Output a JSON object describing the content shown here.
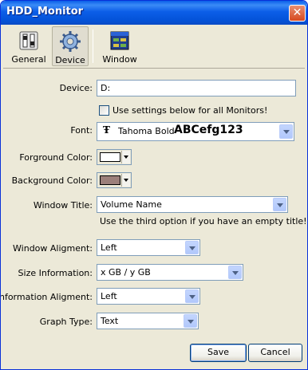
{
  "window": {
    "title": "HDD_Monitor",
    "close_glyph": "✕"
  },
  "toolbar": {
    "items": [
      {
        "label": "General",
        "icon": "switches-icon"
      },
      {
        "label": "Device",
        "icon": "gear-icon",
        "active": true
      },
      {
        "label": "Window",
        "icon": "window-icon"
      }
    ]
  },
  "form": {
    "device": {
      "label": "Device:",
      "value": "D:"
    },
    "use_all": {
      "label": "Use settings below for all Monitors!",
      "checked": false
    },
    "font": {
      "label": "Font:",
      "icon_glyph": "Ŧ",
      "name": "Tahoma Bold",
      "sample": "ABCefg123"
    },
    "foreground": {
      "label": "Forground Color:",
      "color": "#ffffff"
    },
    "background": {
      "label": "Background Color:",
      "color": "#9c7f7a"
    },
    "window_title": {
      "label": "Window Title:",
      "value": "Volume Name",
      "hint": "Use the third option if you have an empty title!"
    },
    "window_alignment": {
      "label": "Window Aligment:",
      "value": "Left"
    },
    "size_information": {
      "label": "Size Information:",
      "value": "x GB / y GB"
    },
    "information_alignment": {
      "label": "Information Aligment:",
      "value": "Left"
    },
    "graph_type": {
      "label": "Graph Type:",
      "value": "Text"
    }
  },
  "buttons": {
    "save": "Save",
    "cancel": "Cancel"
  },
  "colors": {
    "titlebar": "#0a5fe9",
    "dialog_bg": "#ece9d8",
    "field_border": "#7f9db9"
  }
}
